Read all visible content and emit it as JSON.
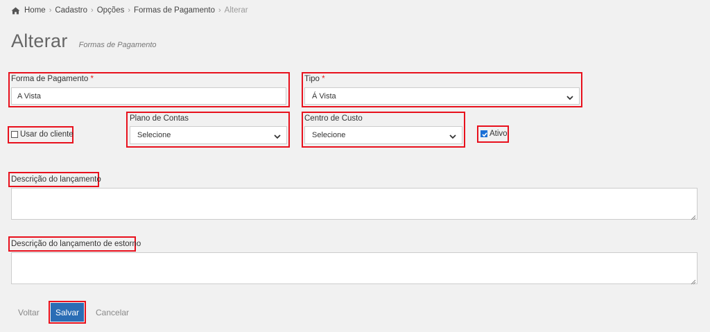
{
  "breadcrumb": {
    "items": [
      "Home",
      "Cadastro",
      "Opções",
      "Formas de Pagamento"
    ],
    "current": "Alterar",
    "home_icon": "home-icon"
  },
  "header": {
    "title": "Alterar",
    "subtitle": "Formas de Pagamento"
  },
  "form": {
    "forma_pagamento": {
      "label": "Forma de Pagamento",
      "required": "*",
      "value": "A Vista"
    },
    "tipo": {
      "label": "Tipo",
      "required": "*",
      "value": "Á Vista"
    },
    "usar_cliente": {
      "label": "Usar do cliente",
      "checked": false
    },
    "plano_contas": {
      "label": "Plano de Contas",
      "value": "Selecione"
    },
    "centro_custo": {
      "label": "Centro de Custo",
      "value": "Selecione"
    },
    "ativo": {
      "label": "Ativo",
      "checked": true
    },
    "descricao": {
      "label": "Descrição do lançamento",
      "value": ""
    },
    "descricao_estorno": {
      "label": "Descrição do lançamento de estorno",
      "value": ""
    }
  },
  "actions": {
    "voltar": "Voltar",
    "salvar": "Salvar",
    "cancelar": "Cancelar"
  },
  "colors": {
    "highlight": "#e8101c",
    "primary": "#2a6db5",
    "checkbox": "#1a6fd6"
  }
}
